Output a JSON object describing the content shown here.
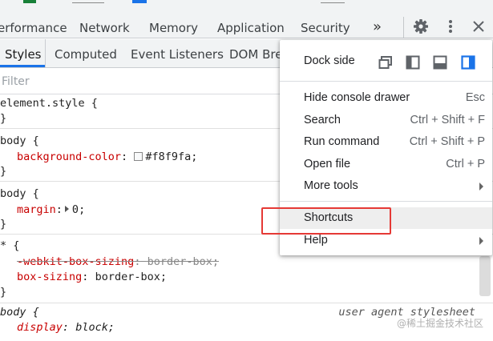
{
  "main_tabs": {
    "performance": "erformance",
    "network": "Network",
    "memory": "Memory",
    "application": "Application",
    "security": "Security",
    "more": "»"
  },
  "sub_tabs": {
    "styles": "Styles",
    "computed": "Computed",
    "event_listeners": "Event Listeners",
    "dom_breakpoints": "DOM Brea"
  },
  "filter": {
    "placeholder": "Filter",
    "value": ""
  },
  "rules": {
    "element_style": {
      "selector": "element.style",
      "open": " {",
      "close": "}"
    },
    "body_bg": {
      "selector": "body",
      "open": " {",
      "prop": "background-color",
      "colon": ":",
      "value": "#f8f9fa",
      "semi": ";",
      "close": "}",
      "swatch": "#f8f9fa"
    },
    "body_margin": {
      "selector": "body",
      "open": " {",
      "prop": "margin",
      "colon": ":",
      "value": "0",
      "semi": ";",
      "close": "}"
    },
    "universal": {
      "selector": "*",
      "open": " {",
      "prop1": "-webkit-box-sizing",
      "value1": "border-box",
      "prop2": "box-sizing",
      "value2": "border-box",
      "colon": ":",
      "semi": ";",
      "close": "}"
    },
    "body_ua": {
      "selector": "body",
      "open": " {",
      "source": "user agent stylesheet",
      "prop": "display",
      "colon": ":",
      "value": "block",
      "semi": ";"
    }
  },
  "menu": {
    "dock_side": "Dock side",
    "items": [
      {
        "label": "Hide console drawer",
        "shortcut": "Esc"
      },
      {
        "label": "Search",
        "shortcut": "Ctrl + Shift + F"
      },
      {
        "label": "Run command",
        "shortcut": "Ctrl + Shift + P"
      },
      {
        "label": "Open file",
        "shortcut": "Ctrl + P"
      },
      {
        "label": "More tools",
        "shortcut": ""
      },
      {
        "label": "Shortcuts",
        "shortcut": ""
      },
      {
        "label": "Help",
        "shortcut": ""
      }
    ]
  },
  "watermark": "@稀土掘金技术社区",
  "colors": {
    "accent": "#1a73e8",
    "highlight_box": "#e53935",
    "css_property": "#c80000"
  }
}
